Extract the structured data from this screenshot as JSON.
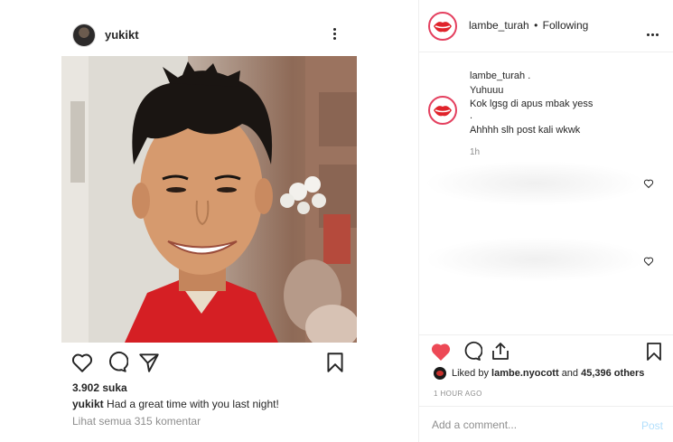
{
  "left_post": {
    "username": "yukikt",
    "likes": "3.902 suka",
    "caption_user": "yukikt",
    "caption_text": "Had a great time with you last night!",
    "view_comments": "Lihat semua 315 komentar",
    "icons": [
      "heart-outline-icon",
      "comment-icon",
      "share-icon",
      "bookmark-icon",
      "more-vertical-icon"
    ]
  },
  "right_panel": {
    "username": "lambe_turah",
    "separator": "•",
    "follow_status": "Following",
    "comment": {
      "user": "lambe_turah .",
      "lines": [
        "Yuhuuu",
        "Kok lgsg di apus mbak yess",
        ".",
        "Ahhhh slh post kali wkwk"
      ],
      "time": "1h"
    },
    "liked_by": {
      "prefix": "Liked by",
      "user": "lambe.nyocott",
      "middle": "and",
      "count": "45,396 others"
    },
    "post_time": "1 HOUR AGO",
    "add_comment_placeholder": "Add a comment...",
    "post_button": "Post",
    "colors": {
      "like_red": "#ed4956",
      "avatar_ring": "#e4405f",
      "post_disabled": "#b2dffc"
    },
    "icons": [
      "heart-filled-icon",
      "comment-icon",
      "share-icon",
      "bookmark-icon",
      "more-horizontal-icon"
    ]
  }
}
